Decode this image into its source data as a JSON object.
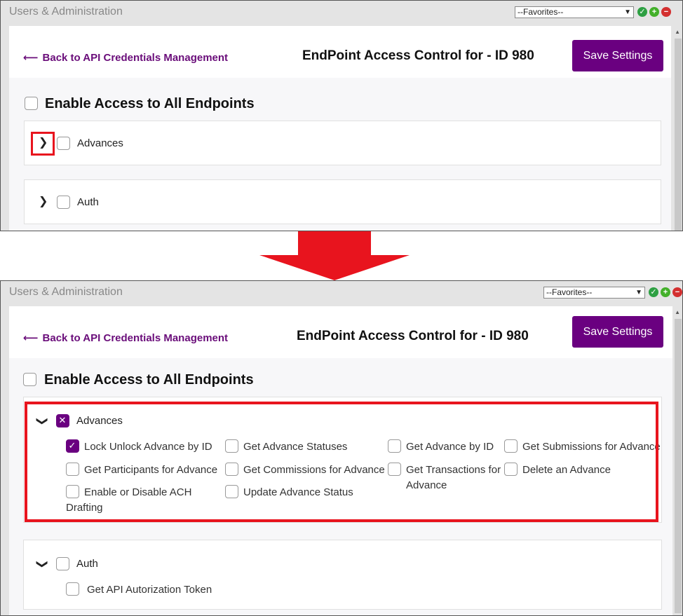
{
  "app_title": "Users & Administration",
  "favorites": "--Favorites--",
  "back_link": "Back to API Credentials Management",
  "page_title": "EndPoint Access Control for - ID 980",
  "save_button": "Save Settings",
  "enable_all": "Enable Access to All Endpoints",
  "before": {
    "groups": [
      {
        "label": "Advances",
        "expanded": false,
        "checked": false
      },
      {
        "label": "Auth",
        "expanded": false,
        "checked": false
      }
    ]
  },
  "after": {
    "advances": {
      "label": "Advances",
      "expanded": true,
      "state": "indeterminate",
      "items": [
        {
          "label": "Lock Unlock Advance by ID",
          "checked": true
        },
        {
          "label": "Get Advance Statuses",
          "checked": false
        },
        {
          "label": "Get Advance by ID",
          "checked": false
        },
        {
          "label": "Get Submissions for Advance",
          "checked": false
        },
        {
          "label": "Get Participants for Advance",
          "checked": false
        },
        {
          "label": "Get Commissions for Advance",
          "checked": false
        },
        {
          "label": "Get Transactions for Advance",
          "checked": false
        },
        {
          "label": "Delete an Advance",
          "checked": false
        },
        {
          "label": "Enable or Disable ACH Drafting",
          "checked": false
        },
        {
          "label": "Update Advance Status",
          "checked": false
        }
      ]
    },
    "auth": {
      "label": "Auth",
      "expanded": true,
      "items": [
        {
          "label": "Get API Autorization Token",
          "checked": false
        }
      ]
    }
  },
  "colors": {
    "accent": "#6a0080",
    "highlight": "#e8141e",
    "link": "#6a0d7a"
  }
}
